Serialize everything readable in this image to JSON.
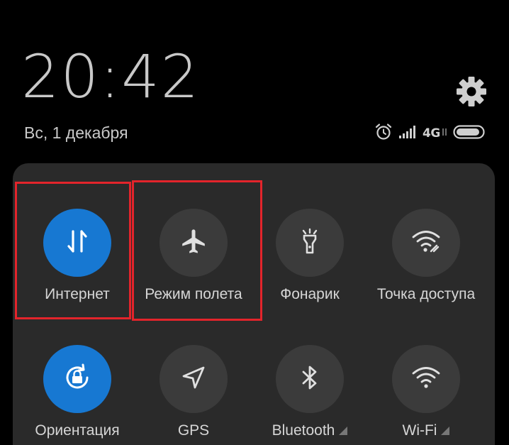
{
  "lockscreen": {
    "time": "20:42",
    "date": "Вс, 1 декабря",
    "network_type": "4G"
  },
  "status_icons": [
    "alarm-icon",
    "signal-icon",
    "battery-icon"
  ],
  "settings_icon": "gear-icon",
  "quick_tiles": [
    {
      "label": "Интернет",
      "icon": "mobile-data-icon",
      "active": true
    },
    {
      "label": "Режим полета",
      "icon": "airplane-icon",
      "active": false
    },
    {
      "label": "Фонарик",
      "icon": "flashlight-icon",
      "active": false
    },
    {
      "label": "Точка доступа",
      "icon": "hotspot-icon",
      "active": false
    },
    {
      "label": "Ориентация",
      "icon": "rotation-lock-icon",
      "active": true
    },
    {
      "label": "GPS",
      "icon": "location-icon",
      "active": false
    },
    {
      "label": "Bluetooth",
      "icon": "bluetooth-icon",
      "active": false,
      "expandable": true
    },
    {
      "label": "Wi-Fi",
      "icon": "wifi-icon",
      "active": false,
      "expandable": true
    }
  ],
  "colors": {
    "background": "#000000",
    "panel": "#2a2a2a",
    "tile_inactive": "#3b3b3b",
    "tile_active": "#1778d2",
    "highlight": "#e3242b"
  }
}
